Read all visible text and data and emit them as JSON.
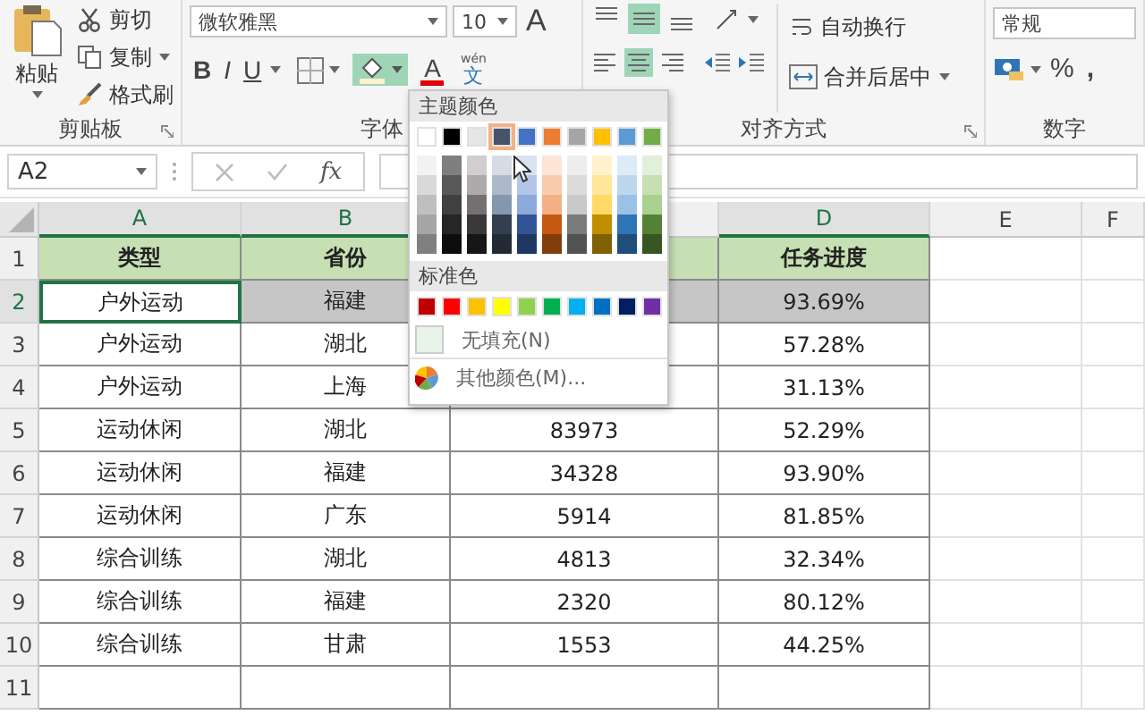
{
  "ribbon": {
    "clipboard": {
      "paste": "粘贴",
      "cut": "剪切",
      "copy": "复制",
      "format_painter": "格式刷",
      "label": "剪贴板"
    },
    "font": {
      "font_name": "微软雅黑",
      "font_size": "10",
      "grow_font": "A",
      "bold": "B",
      "italic": "I",
      "underline": "U",
      "fill_color_button": {
        "selected": true
      },
      "font_color_letter": "A",
      "phonetic_top": "wén",
      "phonetic_char": "文",
      "label": "字体"
    },
    "alignment": {
      "vertical": [
        {
          "kind": "top",
          "selected": false
        },
        {
          "kind": "middle",
          "selected": true
        },
        {
          "kind": "bottom",
          "selected": false
        }
      ],
      "horizontal": [
        {
          "kind": "left",
          "selected": false
        },
        {
          "kind": "center",
          "selected": true
        },
        {
          "kind": "right",
          "selected": false
        }
      ],
      "wrap_text": "自动换行",
      "merge_center": "合并后居中",
      "label": "对齐方式"
    },
    "number": {
      "format": "常规",
      "percent": "%",
      "comma": ",",
      "label": "数字"
    }
  },
  "formula_bar": {
    "name_box": "A2",
    "fx": "fx"
  },
  "sheet": {
    "columns": [
      {
        "label": "A",
        "selected": true
      },
      {
        "label": "B",
        "selected": true
      },
      {},
      {
        "label": "D",
        "selected": true
      },
      {
        "label": "E",
        "selected": false
      },
      {
        "label": "F",
        "selected": false
      }
    ],
    "rows": [
      {
        "number": "1",
        "kind": "header",
        "selected": false,
        "cells": {
          "a": "类型",
          "b": "省份",
          "d": "任务进度"
        }
      },
      {
        "number": "2",
        "kind": "data",
        "selected": true,
        "cells": {
          "a": "户外运动",
          "b": "福建",
          "d": "93.69%"
        }
      },
      {
        "number": "3",
        "kind": "data",
        "selected": false,
        "cells": {
          "a": "户外运动",
          "b": "湖北",
          "d": "57.28%"
        }
      },
      {
        "number": "4",
        "kind": "data",
        "selected": false,
        "cells": {
          "a": "户外运动",
          "b": "上海",
          "d": "31.13%"
        }
      },
      {
        "number": "5",
        "kind": "data",
        "selected": false,
        "cells": {
          "a": "运动休闲",
          "b": "湖北",
          "c": "83973",
          "d": "52.29%"
        }
      },
      {
        "number": "6",
        "kind": "data",
        "selected": false,
        "cells": {
          "a": "运动休闲",
          "b": "福建",
          "c": "34328",
          "d": "93.90%"
        }
      },
      {
        "number": "7",
        "kind": "data",
        "selected": false,
        "cells": {
          "a": "运动休闲",
          "b": "广东",
          "c": "5914",
          "d": "81.85%"
        }
      },
      {
        "number": "8",
        "kind": "data",
        "selected": false,
        "cells": {
          "a": "综合训练",
          "b": "湖北",
          "c": "4813",
          "d": "32.34%"
        }
      },
      {
        "number": "9",
        "kind": "data",
        "selected": false,
        "cells": {
          "a": "综合训练",
          "b": "福建",
          "c": "2320",
          "d": "80.12%"
        }
      },
      {
        "number": "10",
        "kind": "data",
        "selected": false,
        "cells": {
          "a": "综合训练",
          "b": "甘肃",
          "c": "1553",
          "d": "44.25%"
        }
      },
      {
        "number": "11",
        "kind": "data",
        "selected": false
      }
    ]
  },
  "fill_menu": {
    "theme_title": "主题颜色",
    "theme_colors": [
      {
        "color": "#ffffff",
        "selected": false
      },
      {
        "color": "#000000",
        "selected": false
      },
      {
        "color": "#e7e6e6",
        "selected": false
      },
      {
        "color": "#44546a",
        "selected": true
      },
      {
        "color": "#4472c4",
        "selected": false
      },
      {
        "color": "#ed7d31",
        "selected": false
      },
      {
        "color": "#a5a5a5",
        "selected": false
      },
      {
        "color": "#ffc000",
        "selected": false
      },
      {
        "color": "#5b9bd5",
        "selected": false
      },
      {
        "color": "#70ad47",
        "selected": false
      }
    ],
    "shade_columns": [
      {
        "shades": [
          {
            "color": "#f2f2f2"
          },
          {
            "color": "#d9d9d9"
          },
          {
            "color": "#bfbfbf"
          },
          {
            "color": "#a6a6a6"
          },
          {
            "color": "#808080"
          }
        ]
      },
      {
        "shades": [
          {
            "color": "#7f7f7f"
          },
          {
            "color": "#595959"
          },
          {
            "color": "#404040"
          },
          {
            "color": "#262626"
          },
          {
            "color": "#0d0d0d"
          }
        ]
      },
      {
        "shades": [
          {
            "color": "#d0cece"
          },
          {
            "color": "#aeaaaa"
          },
          {
            "color": "#757171"
          },
          {
            "color": "#3a3838"
          },
          {
            "color": "#171616"
          }
        ]
      },
      {
        "shades": [
          {
            "color": "#d6dce4"
          },
          {
            "color": "#adb9ca"
          },
          {
            "color": "#8497b0"
          },
          {
            "color": "#333f4f"
          },
          {
            "color": "#222b35"
          }
        ]
      },
      {
        "shades": [
          {
            "color": "#d9e1f2"
          },
          {
            "color": "#b4c6e7"
          },
          {
            "color": "#8ea9db"
          },
          {
            "color": "#305496"
          },
          {
            "color": "#203764"
          }
        ]
      },
      {
        "shades": [
          {
            "color": "#fce4d6"
          },
          {
            "color": "#f8cbad"
          },
          {
            "color": "#f4b084"
          },
          {
            "color": "#c65911"
          },
          {
            "color": "#833c0c"
          }
        ]
      },
      {
        "shades": [
          {
            "color": "#ededed"
          },
          {
            "color": "#dbdbdb"
          },
          {
            "color": "#c9c9c9"
          },
          {
            "color": "#7b7b7b"
          },
          {
            "color": "#525252"
          }
        ]
      },
      {
        "shades": [
          {
            "color": "#fff2cc"
          },
          {
            "color": "#ffe699"
          },
          {
            "color": "#ffd966"
          },
          {
            "color": "#bf8f00"
          },
          {
            "color": "#806000"
          }
        ]
      },
      {
        "shades": [
          {
            "color": "#ddebf7"
          },
          {
            "color": "#bdd7ee"
          },
          {
            "color": "#9bc2e6"
          },
          {
            "color": "#2f75b5"
          },
          {
            "color": "#1f4e78"
          }
        ]
      },
      {
        "shades": [
          {
            "color": "#e2efda"
          },
          {
            "color": "#c6e0b4"
          },
          {
            "color": "#a9d08e"
          },
          {
            "color": "#548235"
          },
          {
            "color": "#375623"
          }
        ]
      }
    ],
    "standard_title": "标准色",
    "standard_colors": [
      {
        "color": "#c00000"
      },
      {
        "color": "#ff0000"
      },
      {
        "color": "#ffc000"
      },
      {
        "color": "#ffff00"
      },
      {
        "color": "#92d050"
      },
      {
        "color": "#00b050"
      },
      {
        "color": "#00b0f0"
      },
      {
        "color": "#0070c0"
      },
      {
        "color": "#002060"
      },
      {
        "color": "#7030a0"
      }
    ],
    "no_fill": "无填充(N)",
    "more_colors": "其他颜色(M)..."
  }
}
